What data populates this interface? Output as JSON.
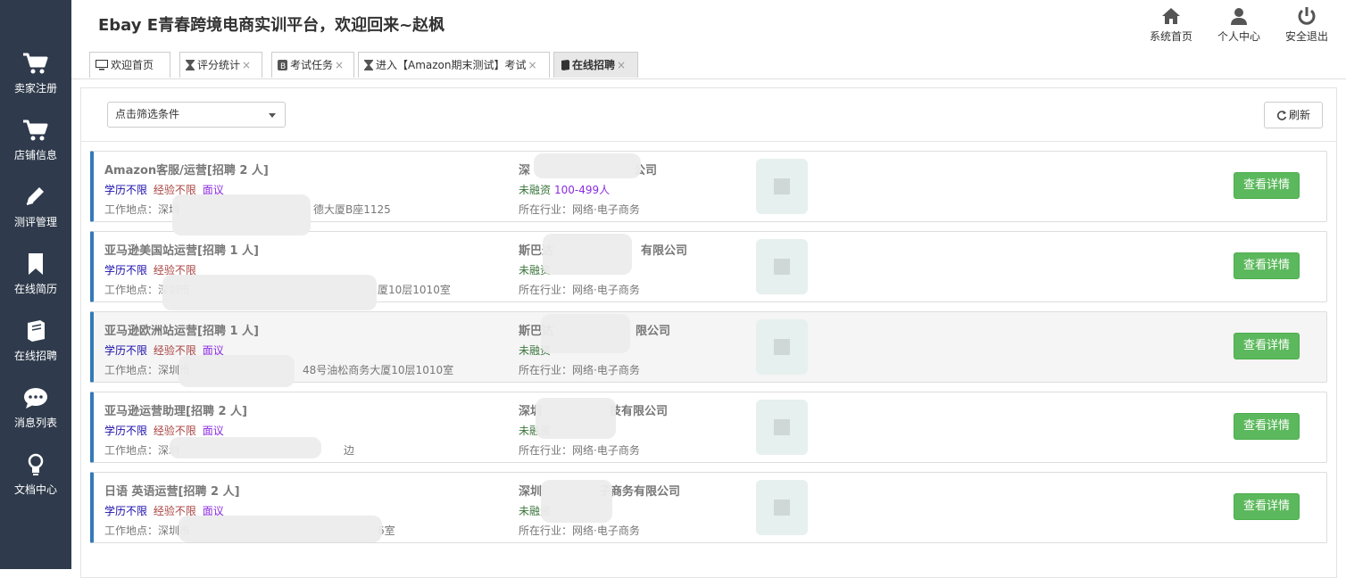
{
  "header": {
    "title": "Ebay E青春跨境电商实训平台，欢迎回来~赵枫"
  },
  "top_actions": [
    {
      "label": "系统首页",
      "icon": "home-icon"
    },
    {
      "label": "个人中心",
      "icon": "user-icon"
    },
    {
      "label": "安全退出",
      "icon": "power-icon"
    }
  ],
  "sidebar": {
    "items": [
      {
        "label": "卖家注册",
        "icon": "cart-icon"
      },
      {
        "label": "店铺信息",
        "icon": "cart-icon"
      },
      {
        "label": "测评管理",
        "icon": "pencil-icon"
      },
      {
        "label": "在线简历",
        "icon": "bookmark-icon"
      },
      {
        "label": "在线招聘",
        "icon": "book-icon"
      },
      {
        "label": "消息列表",
        "icon": "chat-icon"
      },
      {
        "label": "文档中心",
        "icon": "lightbulb-icon"
      }
    ]
  },
  "tabs": [
    {
      "label": "欢迎首页",
      "icon": "desktop-icon",
      "closable": false
    },
    {
      "label": "评分统计",
      "icon": "hourglass-icon",
      "closable": true,
      "close": "×"
    },
    {
      "label": "考试任务",
      "icon": "exam-icon",
      "closable": true,
      "close": "×"
    },
    {
      "label": "进入【Amazon期末测试】考试",
      "icon": "hourglass-icon",
      "closable": true,
      "close": "×"
    },
    {
      "label": "在线招聘",
      "icon": "book-icon",
      "closable": true,
      "close": "×",
      "active": true
    }
  ],
  "toolbar": {
    "filter_placeholder": "点击筛选条件",
    "refresh_label": "刷新"
  },
  "jobs": [
    {
      "title": "Amazon客服/运营[招聘 2 人]",
      "education": "学历不限",
      "experience": "经验不限",
      "salary": "面议",
      "location": "工作地点：深圳",
      "location_tail": "德大厦B座1125",
      "company_head": "深",
      "company_tail": "公司",
      "funding": "未融资",
      "size": "100-499人",
      "industry": "所在行业：网络·电子商务",
      "button": "查看详情"
    },
    {
      "title": "亚马逊美国站运营[招聘 1 人]",
      "education": "学历不限",
      "experience": "经验不限",
      "salary": "",
      "location": "工作地点：深圳市",
      "location_tail": "厦10层1010室",
      "company_head": "斯巴达",
      "company_tail": "有限公司",
      "funding": "未融资",
      "size": "",
      "industry": "所在行业：网络·电子商务",
      "button": "查看详情"
    },
    {
      "title": "亚马逊欧洲站运营[招聘 1 人]",
      "education": "学历不限",
      "experience": "经验不限",
      "salary": "面议",
      "location": "工作地点：深圳市",
      "location_tail": "48号油松商务大厦10层1010室",
      "company_head": "斯巴达",
      "company_tail": "限公司",
      "funding": "未融资",
      "size": "",
      "industry": "所在行业：网络·电子商务",
      "button": "查看详情"
    },
    {
      "title": "亚马逊运营助理[招聘 2 人]",
      "education": "学历不限",
      "experience": "经验不限",
      "salary": "面议",
      "location": "工作地点：深圳",
      "location_tail": "边",
      "company_head": "深圳",
      "company_tail": "技有限公司",
      "funding": "未融资",
      "size": "",
      "industry": "所在行业：网络·电子商务",
      "button": "查看详情"
    },
    {
      "title": "日语 英语运营[招聘 2 人]",
      "education": "学历不限",
      "experience": "经验不限",
      "salary": "面议",
      "location": "工作地点：深圳市",
      "location_tail": "6室",
      "company_head": "深圳",
      "company_tail": "子商务有限公司",
      "funding": "未融资",
      "size": "",
      "industry": "所在行业：网络·电子商务",
      "button": "查看详情"
    }
  ],
  "colors": {
    "sidebar_bg": "#2f3b4c",
    "button_green": "#5cb85c",
    "card_accent": "#337ab7"
  }
}
